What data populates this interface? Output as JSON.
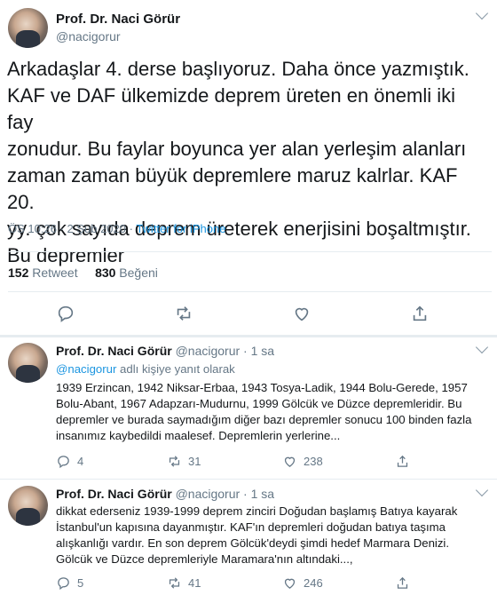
{
  "main_tweet": {
    "author_name": "Prof. Dr. Naci Görür",
    "author_handle": "@nacigorur",
    "text": "Arkadaşlar 4. derse başlıyoruz. Daha önce yazmıştık.\nKAF ve DAF ülkemizde deprem üreten en önemli iki fay\nzonudur. Bu faylar boyunca yer alan yerleşim alanları\nzaman zaman büyük depremlere maruz kalrlar. KAF 20.\nyy. çok sayıda deprem üreterek enerjisini boşaltmıştır.\nBu depremler",
    "timestamp": "ÖS 10:26 · 2 Şub 2020 · ",
    "client": "Twitter for iPhone",
    "retweet_count": "152",
    "retweet_label": " Retweet",
    "like_count": "830",
    "like_label": " Beğeni"
  },
  "replies": [
    {
      "author_name": "Prof. Dr. Naci Görür",
      "author_handle": "@nacigorur · 1 sa",
      "reply_mention": "@nacigorur",
      "reply_context": " adlı kişiye yanıt olarak",
      "text": "1939 Erzincan, 1942 Niksar-Erbaa, 1943 Tosya-Ladik, 1944 Bolu-Gerede, 1957 Bolu-Abant, 1967 Adapzarı-Mudurnu, 1999 Gölcük ve Düzce depremleridir. Bu depremler ve burada saymadığım diğer bazı depremler sonucu 100 binden fazla insanımız kaybedildi maalesef. Depremlerin yerlerine...",
      "reply_count": "4",
      "retweet_count": "31",
      "like_count": "238"
    },
    {
      "author_name": "Prof. Dr. Naci Görür",
      "author_handle": "@nacigorur · 1 sa",
      "text": "dikkat ederseniz 1939-1999 deprem zinciri Doğudan başlamış Batıya kayarak İstanbul'un kapısına dayanmıştır. KAF'ın depremleri doğudan batıya taşıma alışkanlığı vardır. En son deprem Gölcük'deydi şimdi hedef Marmara Denizi. Gölcük ve Düzce depremleriyle Maramara'nın altındaki...,",
      "reply_count": "5",
      "retweet_count": "41",
      "like_count": "246"
    }
  ],
  "icons": {
    "reply": "reply-icon",
    "retweet": "retweet-icon",
    "like": "heart-icon",
    "share": "share-icon",
    "more": "chevron-down-icon"
  },
  "colors": {
    "accent": "#1b95e0",
    "muted": "#657786",
    "text": "#14171a",
    "divider": "#e6ecf0"
  }
}
